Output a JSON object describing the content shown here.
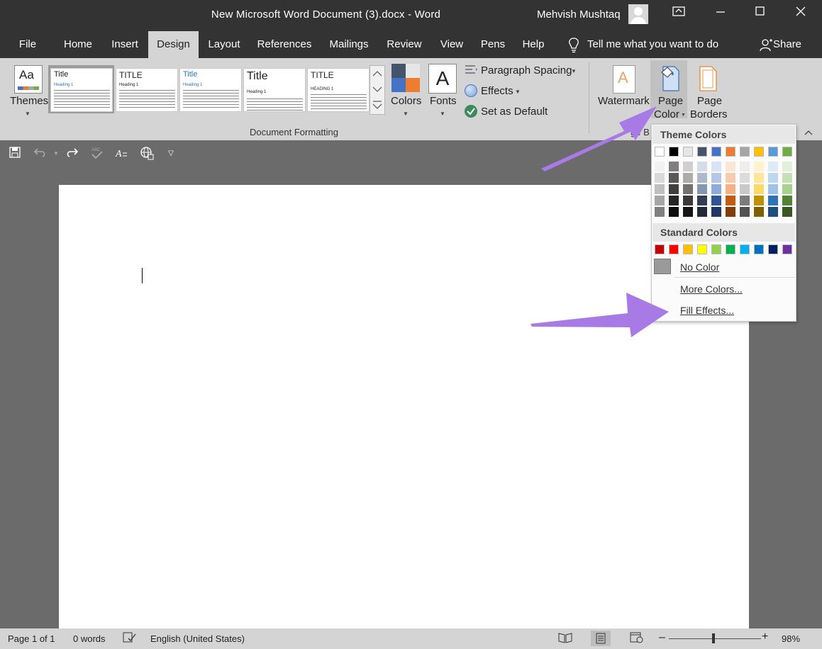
{
  "window": {
    "title": "New Microsoft Word Document (3).docx  -  Word",
    "user": "Mehvish Mushtaq"
  },
  "tabs": [
    "File",
    "Home",
    "Insert",
    "Design",
    "Layout",
    "References",
    "Mailings",
    "Review",
    "View",
    "Pens",
    "Help"
  ],
  "active_tab": "Design",
  "tell_me": "Tell me what you want to do",
  "share_label": "Share",
  "ribbon": {
    "themes_label": "Themes",
    "gallery": [
      {
        "title": "Title",
        "heading": "Heading 1"
      },
      {
        "title": "TITLE",
        "heading": "Heading 1"
      },
      {
        "title": "Title",
        "heading": "Heading 1"
      },
      {
        "title": "Title",
        "heading": "Heading 1"
      },
      {
        "title": "TITLE",
        "heading": "HEADING 1"
      }
    ],
    "colors_label": "Colors",
    "fonts_label": "Fonts",
    "fonts_glyph": "A",
    "paragraph_spacing": "Paragraph Spacing",
    "effects": "Effects",
    "set_default": "Set as Default",
    "group_document_formatting": "Document Formatting",
    "watermark": "Watermark",
    "page_color_line1": "Page",
    "page_color_line2": "Color",
    "page_borders_line1": "Page",
    "page_borders_line2": "Borders",
    "group_page_bg_partial": "ge B"
  },
  "dropdown": {
    "theme_colors_label": "Theme Colors",
    "theme_top": [
      "#ffffff",
      "#000000",
      "#e7e6e6",
      "#44546a",
      "#4472c4",
      "#ed7d31",
      "#a5a5a5",
      "#ffc000",
      "#5b9bd5",
      "#70ad47"
    ],
    "theme_shades": [
      [
        "#f2f2f2",
        "#d9d9d9",
        "#bfbfbf",
        "#a6a6a6",
        "#808080"
      ],
      [
        "#7f7f7f",
        "#595959",
        "#3f3f3f",
        "#262626",
        "#0d0d0d"
      ],
      [
        "#d0cece",
        "#aeabab",
        "#757171",
        "#3a3838",
        "#161616"
      ],
      [
        "#d6dce5",
        "#adb9ca",
        "#8497b0",
        "#333f50",
        "#222a35"
      ],
      [
        "#dae3f3",
        "#b4c7e7",
        "#8faadc",
        "#2f5597",
        "#1f3864"
      ],
      [
        "#fbe5d6",
        "#f8cbad",
        "#f4b183",
        "#c55a11",
        "#843c0c"
      ],
      [
        "#ededed",
        "#dbdbdb",
        "#c9c9c9",
        "#7b7b7b",
        "#525252"
      ],
      [
        "#fff2cc",
        "#ffe699",
        "#ffd966",
        "#bf9000",
        "#7f6000"
      ],
      [
        "#deebf7",
        "#bdd7ee",
        "#9dc3e6",
        "#2e75b6",
        "#1f4e79"
      ],
      [
        "#e2f0d9",
        "#c5e0b4",
        "#a9d18e",
        "#548235",
        "#385723"
      ]
    ],
    "standard_colors_label": "Standard Colors",
    "standard": [
      "#c00000",
      "#ff0000",
      "#ffc000",
      "#ffff00",
      "#92d050",
      "#00b050",
      "#00b0f0",
      "#0070c0",
      "#002060",
      "#7030a0"
    ],
    "no_color": "No Color",
    "more_colors": "More Colors...",
    "fill_effects": "Fill Effects..."
  },
  "status": {
    "page": "Page 1 of 1",
    "words": "0 words",
    "language": "English (United States)",
    "zoom": "98%"
  },
  "colors": {
    "annotation_arrow": "#a77ae6",
    "titlebar": "#333333",
    "ribbon": "#d4d4d4"
  }
}
